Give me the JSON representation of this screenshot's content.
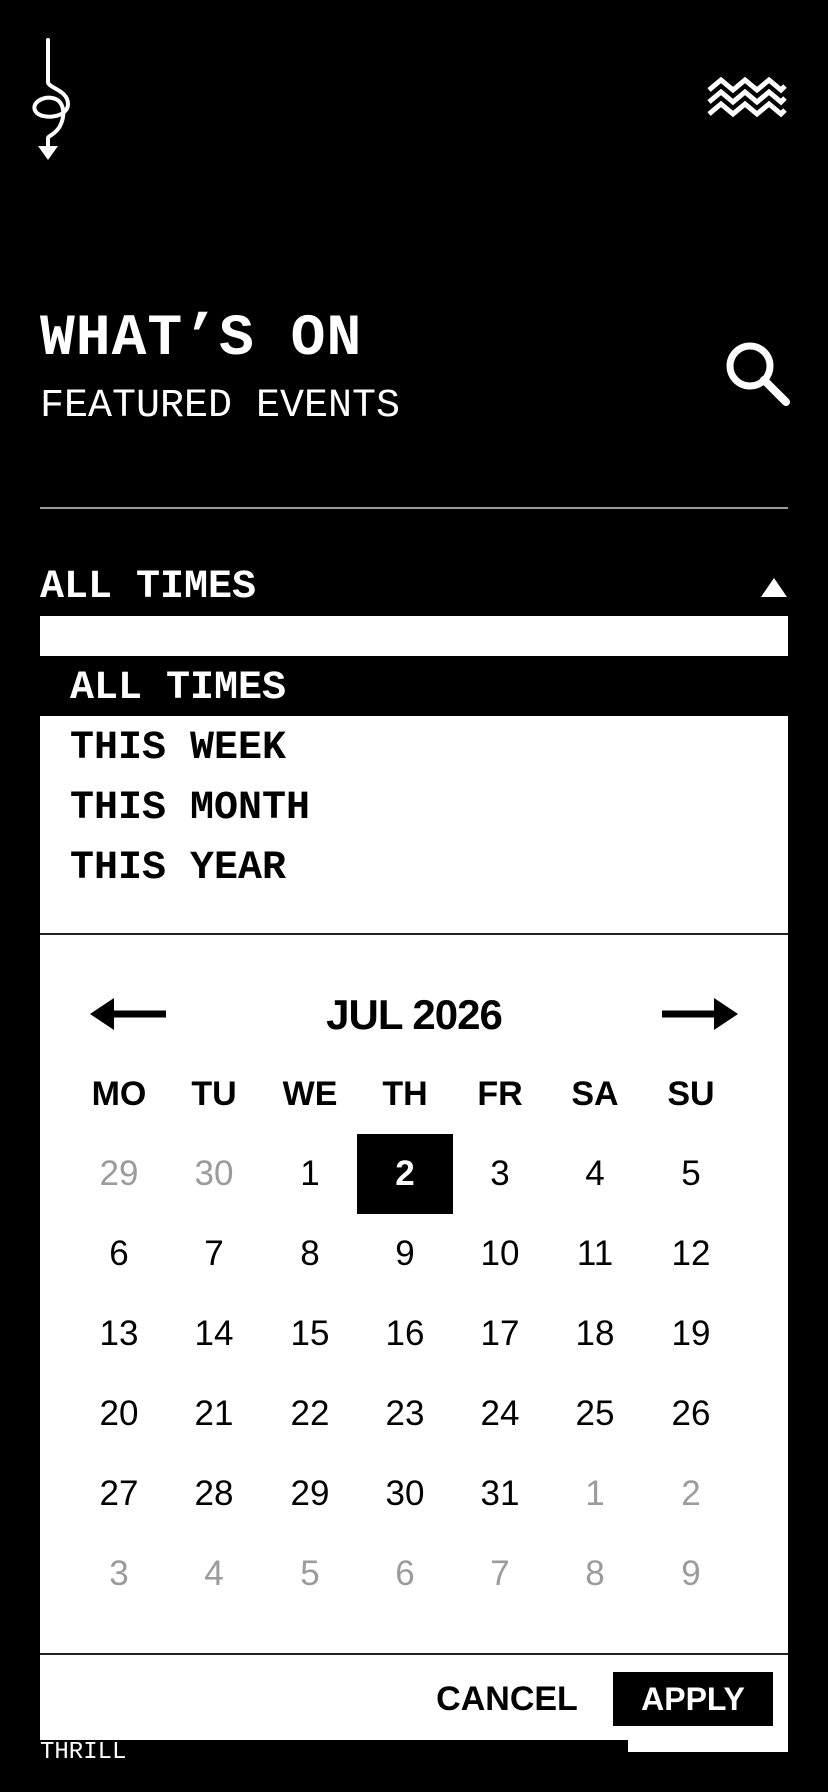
{
  "header": {
    "logo_icon": "spiral-arrow-logo-icon",
    "menu_icon": "zigzag-menu-icon"
  },
  "hero": {
    "title": "WHAT’S ON",
    "subtitle": "FEATURED EVENTS",
    "search_icon": "search-icon"
  },
  "time_filter": {
    "selected_label": "ALL TIMES",
    "caret_icon": "caret-up-icon",
    "options": [
      {
        "label": "ALL TIMES",
        "selected": true
      },
      {
        "label": "THIS WEEK",
        "selected": false
      },
      {
        "label": "THIS MONTH",
        "selected": false
      },
      {
        "label": "THIS YEAR",
        "selected": false
      }
    ]
  },
  "calendar": {
    "month_label": "JUL 2026",
    "prev_icon": "arrow-left-icon",
    "next_icon": "arrow-right-icon",
    "weekdays": [
      "MO",
      "TU",
      "WE",
      "TH",
      "FR",
      "SA",
      "SU"
    ],
    "weeks": [
      [
        {
          "d": "29",
          "m": true
        },
        {
          "d": "30",
          "m": true
        },
        {
          "d": "1"
        },
        {
          "d": "2",
          "s": true
        },
        {
          "d": "3"
        },
        {
          "d": "4"
        },
        {
          "d": "5"
        }
      ],
      [
        {
          "d": "6"
        },
        {
          "d": "7"
        },
        {
          "d": "8"
        },
        {
          "d": "9"
        },
        {
          "d": "10"
        },
        {
          "d": "11"
        },
        {
          "d": "12"
        }
      ],
      [
        {
          "d": "13"
        },
        {
          "d": "14"
        },
        {
          "d": "15"
        },
        {
          "d": "16"
        },
        {
          "d": "17"
        },
        {
          "d": "18"
        },
        {
          "d": "19"
        }
      ],
      [
        {
          "d": "20"
        },
        {
          "d": "21"
        },
        {
          "d": "22"
        },
        {
          "d": "23"
        },
        {
          "d": "24"
        },
        {
          "d": "25"
        },
        {
          "d": "26"
        }
      ],
      [
        {
          "d": "27"
        },
        {
          "d": "28"
        },
        {
          "d": "29"
        },
        {
          "d": "30"
        },
        {
          "d": "31"
        },
        {
          "d": "1",
          "m": true
        },
        {
          "d": "2",
          "m": true
        }
      ],
      [
        {
          "d": "3",
          "m": true
        },
        {
          "d": "4",
          "m": true
        },
        {
          "d": "5",
          "m": true
        },
        {
          "d": "6",
          "m": true
        },
        {
          "d": "7",
          "m": true
        },
        {
          "d": "8",
          "m": true
        },
        {
          "d": "9",
          "m": true
        }
      ]
    ]
  },
  "actions": {
    "cancel_label": "CANCEL",
    "apply_label": "APPLY"
  },
  "footer": {
    "brand": "THRILL"
  },
  "colors": {
    "background": "#000000",
    "panel": "#ffffff",
    "muted_day": "#9b9b9b",
    "divider": "#9a9a9a"
  }
}
